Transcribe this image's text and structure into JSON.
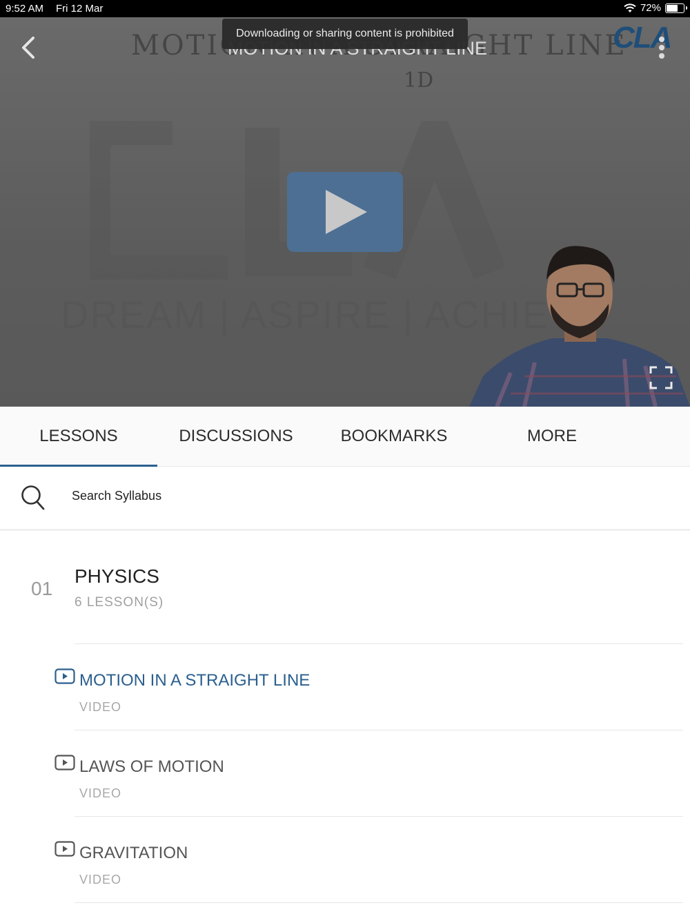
{
  "status_bar": {
    "time": "9:52 AM",
    "date": "Fri 12 Mar",
    "battery": "72%",
    "battery_level": 0.72,
    "icons": [
      "wifi-icon",
      "battery-icon"
    ]
  },
  "player": {
    "whiteboard_title": "MOTION IN A STRAIGHT LINE",
    "whiteboard_subtitle": "1D",
    "video_title": "MOTION IN A STRAIGHT LINE",
    "toast": "Downloading or sharing content is prohibited",
    "brand": "CLA",
    "watermark": "DREAM | ASPIRE | ACHIEVE",
    "icons": [
      "back-chevron-icon",
      "more-vertical-icon",
      "play-icon",
      "fullscreen-icon"
    ],
    "accent_color": "#4d6f94"
  },
  "tabs": [
    {
      "label": "LESSONS",
      "active": true
    },
    {
      "label": "DISCUSSIONS",
      "active": false
    },
    {
      "label": "BOOKMARKS",
      "active": false
    },
    {
      "label": "MORE",
      "active": false
    }
  ],
  "search": {
    "label": "Search Syllabus",
    "icon": "search-icon"
  },
  "syllabus": {
    "chapter_number": "01",
    "chapter_title": "PHYSICS",
    "lesson_count": "6 LESSON(S)",
    "lessons": [
      {
        "title": "MOTION IN A STRAIGHT LINE",
        "type": "VIDEO",
        "active": true
      },
      {
        "title": "LAWS OF MOTION",
        "type": "VIDEO",
        "active": false
      },
      {
        "title": "GRAVITATION",
        "type": "VIDEO",
        "active": false
      }
    ],
    "active_color": "#2b5f8e"
  }
}
